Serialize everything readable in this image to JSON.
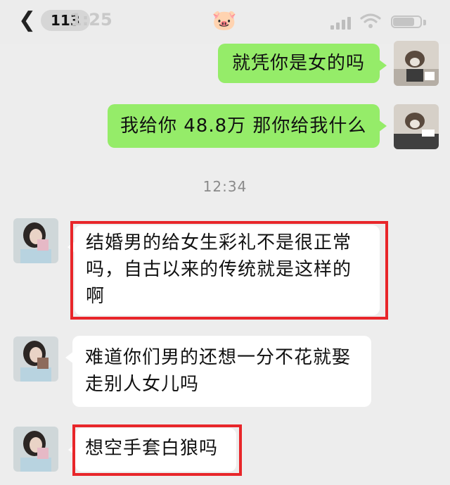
{
  "status_bar": {
    "unread_count": "113",
    "clock_partial": "1:25",
    "chat_title_emoji": "🐷",
    "signal_icon": "cellular-signal-icon",
    "wifi_icon": "wifi-icon",
    "battery_icon": "battery-icon"
  },
  "messages": [
    {
      "sender": "me",
      "text": "就凭你是女的吗"
    },
    {
      "sender": "me",
      "text": "我给你 48.8万 那你给我什么"
    },
    {
      "sender": "them",
      "lines": [
        "结婚男的给女生彩礼不是很正常",
        "吗，自古以来的传统就是这样的",
        "啊"
      ],
      "highlighted": true
    },
    {
      "sender": "them",
      "lines": [
        "难道你们男的还想一分不花就娶",
        "走别人女儿吗"
      ],
      "highlighted": false
    },
    {
      "sender": "them",
      "text": "想空手套白狼吗",
      "highlighted": true
    }
  ],
  "timestamp": "12:34",
  "colors": {
    "background": "#ededed",
    "my_bubble": "#95ec69",
    "their_bubble": "#ffffff",
    "highlight": "#e8262a"
  }
}
